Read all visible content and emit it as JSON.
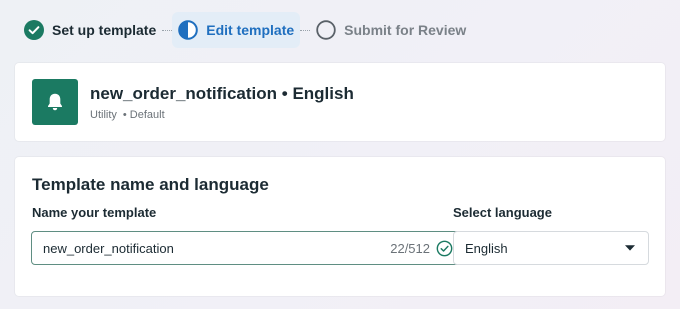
{
  "stepper": {
    "steps": [
      {
        "label": "Set up template",
        "state": "done"
      },
      {
        "label": "Edit template",
        "state": "active"
      },
      {
        "label": "Submit for Review",
        "state": "pending"
      }
    ]
  },
  "template": {
    "name": "new_order_notification",
    "separator": "•",
    "language": "English",
    "category": "Utility",
    "type": "• Default",
    "icon": "bell-icon"
  },
  "form": {
    "section_title": "Template name and language",
    "name_label": "Name your template",
    "name_value": "new_order_notification",
    "char_count": "22/512",
    "language_label": "Select language",
    "language_value": "English"
  },
  "colors": {
    "accent_blue": "#1f6fbf",
    "active_step_bg": "#e3edf7",
    "success_green": "#1b7a62"
  }
}
